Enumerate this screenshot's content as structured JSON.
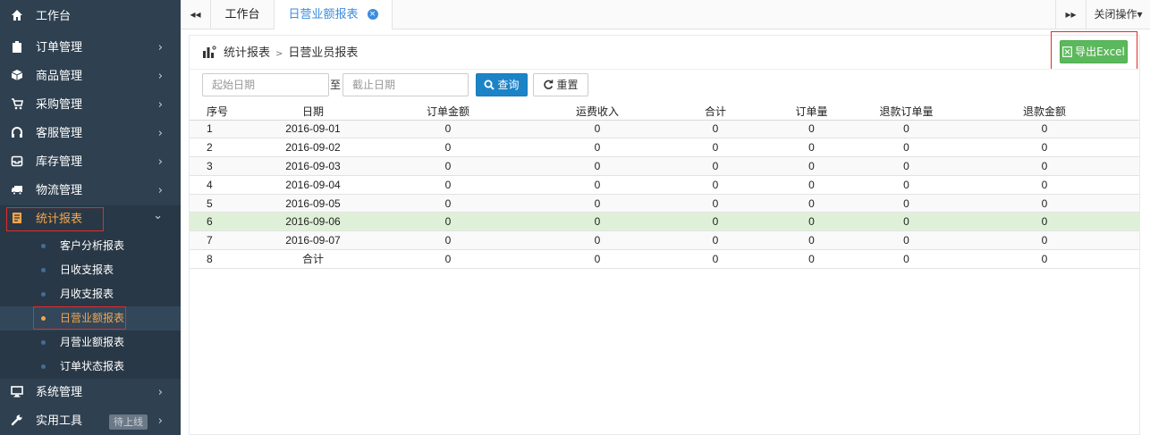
{
  "sidebar": {
    "items": [
      {
        "label": "工作台",
        "icon": "home-icon",
        "arrow": ""
      },
      {
        "label": "订单管理",
        "icon": "clipboard-icon",
        "arrow": "›"
      },
      {
        "label": "商品管理",
        "icon": "cube-icon",
        "arrow": "›"
      },
      {
        "label": "采购管理",
        "icon": "cart-icon",
        "arrow": "›"
      },
      {
        "label": "客服管理",
        "icon": "headset-icon",
        "arrow": "›"
      },
      {
        "label": "库存管理",
        "icon": "inbox-icon",
        "arrow": "›"
      },
      {
        "label": "物流管理",
        "icon": "truck-icon",
        "arrow": "›"
      },
      {
        "label": "统计报表",
        "icon": "report-icon",
        "arrow": "⌄"
      }
    ],
    "sub_items": [
      "客户分析报表",
      "日收支报表",
      "月收支报表",
      "日营业额报表",
      "月营业额报表",
      "订单状态报表"
    ],
    "bottom_items": [
      {
        "label": "系统管理",
        "icon": "desktop-icon",
        "arrow": "›"
      },
      {
        "label": "实用工具",
        "icon": "wrench-icon",
        "arrow": "›",
        "badge": "待上线"
      }
    ]
  },
  "tabbar": {
    "back": "◂◂",
    "home": "工作台",
    "active": "日营业额报表",
    "close_x": "×",
    "forward": "▸▸",
    "close_ops": "关闭操作▾"
  },
  "breadcrumb": {
    "section": "统计报表",
    "separator": ">",
    "page": "日营业员报表"
  },
  "toolbar": {
    "export_label": "导出Excel",
    "start_placeholder": "起始日期",
    "to_label": "至",
    "end_placeholder": "截止日期",
    "query_label": "查询",
    "reset_label": "重置"
  },
  "table": {
    "headers": [
      "序号",
      "日期",
      "订单金额",
      "运费收入",
      "合计",
      "订单量",
      "退款订单量",
      "退款金额"
    ],
    "rows": [
      [
        "1",
        "2016-09-01",
        "0",
        "0",
        "0",
        "0",
        "0",
        "0"
      ],
      [
        "2",
        "2016-09-02",
        "0",
        "0",
        "0",
        "0",
        "0",
        "0"
      ],
      [
        "3",
        "2016-09-03",
        "0",
        "0",
        "0",
        "0",
        "0",
        "0"
      ],
      [
        "4",
        "2016-09-04",
        "0",
        "0",
        "0",
        "0",
        "0",
        "0"
      ],
      [
        "5",
        "2016-09-05",
        "0",
        "0",
        "0",
        "0",
        "0",
        "0"
      ],
      [
        "6",
        "2016-09-06",
        "0",
        "0",
        "0",
        "0",
        "0",
        "0"
      ],
      [
        "7",
        "2016-09-07",
        "0",
        "0",
        "0",
        "0",
        "0",
        "0"
      ],
      [
        "8",
        "合计",
        "0",
        "0",
        "0",
        "0",
        "0",
        "0"
      ]
    ],
    "selected_row": 6
  },
  "colors": {
    "sidebar_bg": "#2f4050",
    "accent": "#f7a54a",
    "tab_active": "#3c8dde",
    "query_btn": "#1c84c6",
    "export_btn": "#5cb85c",
    "selected_row": "#dff0d8",
    "highlight_box": "#e52a2a"
  }
}
